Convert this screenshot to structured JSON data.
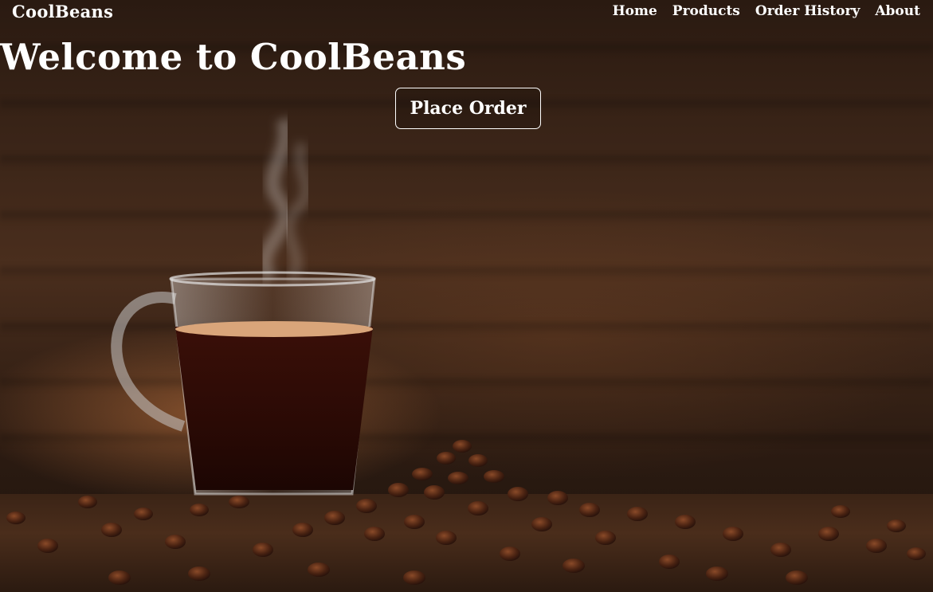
{
  "nav": {
    "brand": "CoolBeans",
    "links": [
      {
        "label": "Home"
      },
      {
        "label": "Products"
      },
      {
        "label": "Order History"
      },
      {
        "label": "About"
      }
    ]
  },
  "hero": {
    "headline": "Welcome to CoolBeans",
    "cta_label": "Place Order",
    "image": "coffee-cup-and-beans-photo"
  },
  "colors": {
    "text": "#ffffff",
    "background_dark": "#1a110b",
    "coffee_brown": "#4a2e1d",
    "crema": "#d9a57a"
  }
}
